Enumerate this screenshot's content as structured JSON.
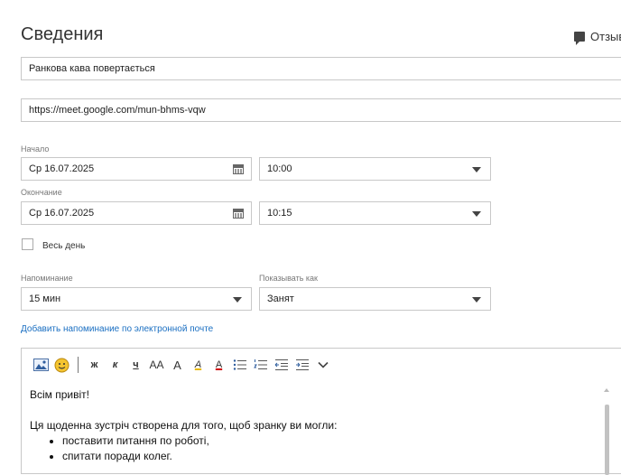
{
  "header": {
    "title": "Сведения",
    "feedback_label": "Отзыв"
  },
  "subject": {
    "value": "Ранкова кава повертається"
  },
  "location": {
    "value": "https://meet.google.com/mun-bhms-vqw"
  },
  "start": {
    "label": "Начало",
    "date": "Ср 16.07.2025",
    "time": "10:00"
  },
  "end": {
    "label": "Окончание",
    "date": "Ср 16.07.2025",
    "time": "10:15"
  },
  "all_day": {
    "label": "Весь день",
    "checked": false
  },
  "reminder": {
    "label": "Напоминание",
    "value": "15 мин"
  },
  "show_as": {
    "label": "Показывать как",
    "value": "Занят"
  },
  "email_reminder_link": "Добавить напоминание по электронной почте",
  "toolbar": {
    "bold": "ж",
    "italic": "к",
    "underline": "ч",
    "font_size": "AA",
    "grow_font": "A",
    "highlight": "A",
    "font_color": "A"
  },
  "editor": {
    "greeting": "Всім привіт!",
    "intro": "Ця щоденна зустріч створена для того, щоб зранку ви могли:",
    "bullets": [
      "поставити питання по роботі,",
      "спитати поради колег."
    ]
  }
}
